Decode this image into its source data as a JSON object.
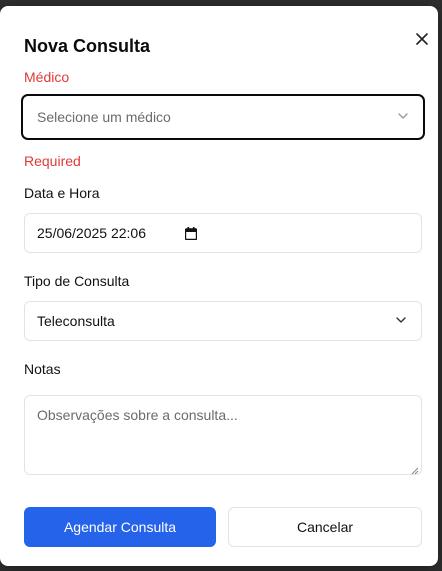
{
  "dialog": {
    "title": "Nova Consulta",
    "close_icon": "close-icon"
  },
  "medico": {
    "label": "Médico",
    "placeholder": "Selecione um médico",
    "error": "Required"
  },
  "data_hora": {
    "label": "Data e Hora",
    "value": "25/06/2025 22:06",
    "icon": "calendar-icon"
  },
  "tipo": {
    "label": "Tipo de Consulta",
    "value": "Teleconsulta"
  },
  "notas": {
    "label": "Notas",
    "placeholder": "Observações sobre a consulta..."
  },
  "actions": {
    "submit_label": "Agendar Consulta",
    "cancel_label": "Cancelar"
  },
  "colors": {
    "primary": "#2563eb",
    "error": "#e03a3a"
  }
}
